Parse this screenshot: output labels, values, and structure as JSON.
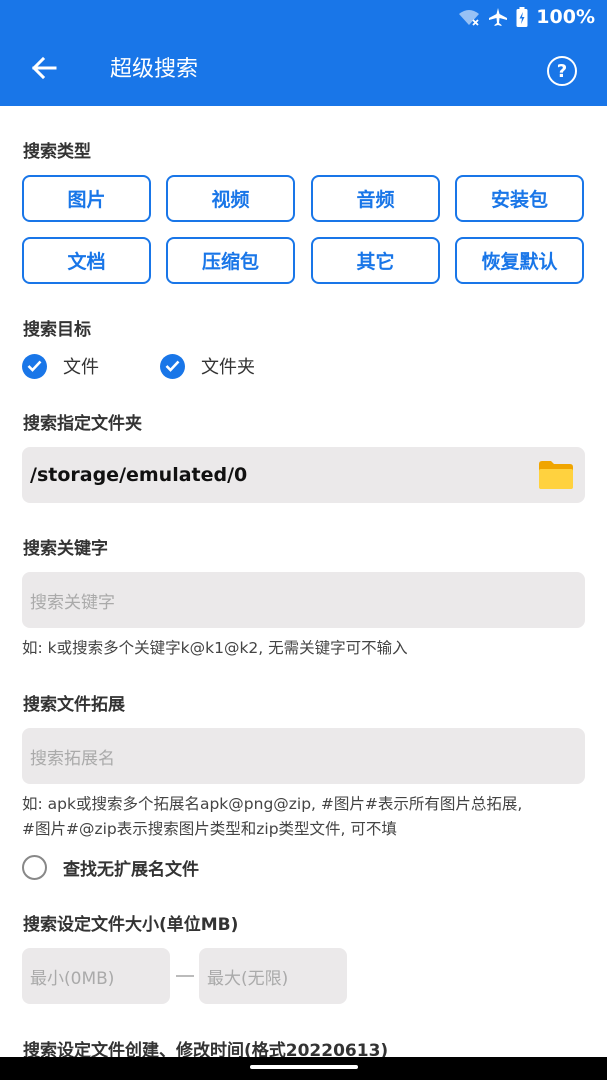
{
  "status": {
    "battery": "100%"
  },
  "appbar": {
    "title": "超级搜索",
    "back_icon": "arrow-left-icon",
    "help_symbol": "?"
  },
  "search_type": {
    "label": "搜索类型",
    "buttons": [
      "图片",
      "视频",
      "音频",
      "安装包",
      "文档",
      "压缩包",
      "其它",
      "恢复默认"
    ]
  },
  "target": {
    "label": "搜索目标",
    "options": [
      {
        "label": "文件",
        "checked": true
      },
      {
        "label": "文件夹",
        "checked": true
      }
    ]
  },
  "folder": {
    "label": "搜索指定文件夹",
    "value": "/storage/emulated/0"
  },
  "keyword": {
    "label": "搜索关键字",
    "placeholder": "搜索关键字",
    "hint": "如: k或搜索多个关键字k@k1@k2, 无需关键字可不输入"
  },
  "extension": {
    "label": "搜索文件拓展",
    "placeholder": "搜索拓展名",
    "hint_line1": "如: apk或搜索多个拓展名apk@png@zip, #图片#表示所有图片总拓展,",
    "hint_line2": "#图片#@zip表示搜索图片类型和zip类型文件, 可不填",
    "no_ext_label": "查找无扩展名文件",
    "no_ext_checked": false
  },
  "size": {
    "label": "搜索设定文件大小(单位MB)",
    "min_placeholder": "最小(0MB)",
    "max_placeholder": "最大(无限)"
  },
  "time": {
    "label": "搜索设定文件创建、修改时间(格式20220613)"
  },
  "colors": {
    "accent": "#1976e8",
    "field_bg": "#ebe9ea"
  }
}
